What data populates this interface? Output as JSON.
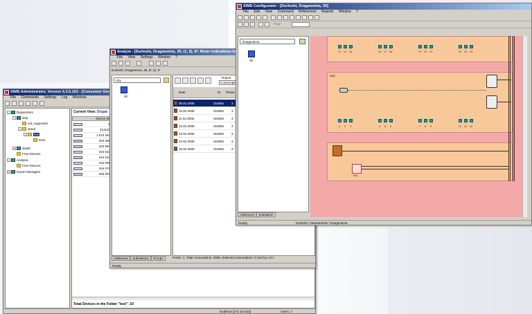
{
  "admin": {
    "title": "SIMS Administrator, Version 5.2.0.162 - [Consumer Groups]",
    "menu": [
      "File",
      "Commands",
      "Settings",
      "Log",
      "Windows"
    ],
    "tree": [
      {
        "label": "Dispatchers"
      },
      {
        "label": "disp"
      },
      {
        "label": "not_supported"
      },
      {
        "label": "stand"
      },
      {
        "label": "test"
      },
      {
        "label": "test1"
      },
      {
        "label": "disakt"
      },
      {
        "label": "Free Devices"
      },
      {
        "label": "Analysis"
      },
      {
        "label": "Free Devices"
      },
      {
        "label": "Export Managers"
      }
    ],
    "current_view_label": "Current View:",
    "current_view_value": "Dispat",
    "column_header": "Device ID",
    "device_ids": [
      "1",
      "313120",
      "1 010 404",
      "333 306",
      "323 663",
      "316 023",
      "315 912",
      "316 065",
      "316 071",
      "465 097"
    ],
    "footer": "Total Devices in the Folder \"test\": 10",
    "status_host": "localhost [172.16.5.53]",
    "status_users": "Users: 2"
  },
  "analyst": {
    "title": "Analyst - [Durlesht, Draganeima, 30, (1, 5), IF: Meter indications for sele",
    "menu": [
      "File",
      "View",
      "Settings",
      "Window",
      "?"
    ],
    "breadcrumb": "Durlesht, Draganeima, 30, (F, 5), IF",
    "city_select": "City",
    "tree_node": "30",
    "tabs": [
      "Addresses",
      "Substations",
      "Groups"
    ],
    "status": "Ready",
    "report_label": "Report",
    "report_value": "Consumption",
    "table_headers": [
      "Date",
      "ID",
      "Phase"
    ],
    "rows": [
      {
        "date": "09.02.2008",
        "id": "316065",
        "phase": "3"
      },
      {
        "date": "10.02.2008",
        "id": "316065",
        "phase": "3"
      },
      {
        "date": "11.02.2008",
        "id": "316065",
        "phase": "3"
      },
      {
        "date": "12.02.2008",
        "id": "316065",
        "phase": "3"
      },
      {
        "date": "13.02.2008",
        "id": "316065",
        "phase": "3"
      },
      {
        "date": "14.02.2008",
        "id": "316065",
        "phase": "3"
      },
      {
        "date": "15.02.2008",
        "id": "316065",
        "phase": "3"
      }
    ],
    "points_status": "Points: 1,  Total consumption: 2695,  Selected consumption: 0    Sort by col 1"
  },
  "configurator": {
    "title": "SIMS Configurator - [Durlesht, Draganeima, 30]",
    "menu": [
      "File",
      "Edit",
      "View",
      "Command",
      "References",
      "Reports",
      "Window",
      "?"
    ],
    "page_label": "Page",
    "street_select": "Draganeima",
    "tree_node": "30",
    "tabs": [
      "Addresses",
      "Substation"
    ],
    "status": "Ready",
    "status_path": "Durlesht \\ NewDurlesht \\ Draganeima",
    "top_labels": [
      "13",
      "14",
      "15",
      "16",
      "17",
      "18",
      "19",
      "20",
      "21",
      "22",
      "23",
      "24"
    ],
    "bottom_labels": [
      "1",
      "2",
      "3",
      "4",
      "5",
      "6",
      "7",
      "8",
      "9",
      "10",
      "11",
      "12"
    ],
    "group_label": "(11)",
    "ext_label": "Ext",
    "colors": {
      "outer": "#f4a9a9",
      "inner": "#f9c89a",
      "device": "#199c9c"
    }
  }
}
